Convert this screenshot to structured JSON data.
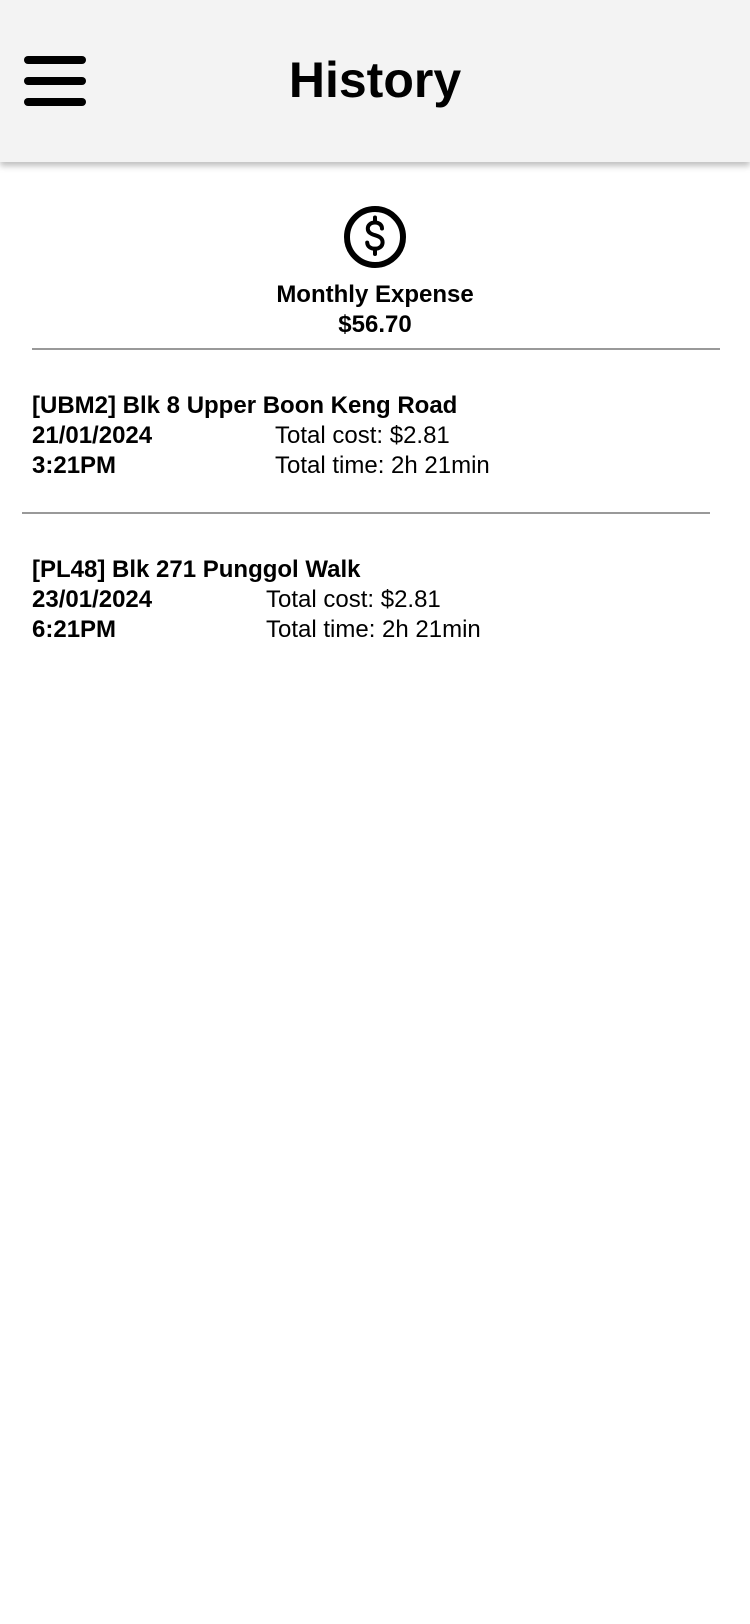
{
  "header": {
    "title": "History",
    "menu_icon": "hamburger-menu-icon"
  },
  "summary": {
    "icon": "dollar-circle-icon",
    "label": "Monthly Expense",
    "amount": "$56.70"
  },
  "entries": [
    {
      "location": "[UBM2] Blk 8 Upper Boon Keng Road",
      "date": "21/01/2024",
      "time": "3:21PM",
      "cost": "Total cost: $2.81",
      "duration": "Total time: 2h 21min"
    },
    {
      "location": "[PL48] Blk 271 Punggol Walk",
      "date": "23/01/2024",
      "time": "6:21PM",
      "cost": "Total cost: $2.81",
      "duration": "Total time: 2h 21min"
    }
  ],
  "colors": {
    "header_bg": "#f3f3f3",
    "divider": "#999999",
    "text": "#000000"
  }
}
